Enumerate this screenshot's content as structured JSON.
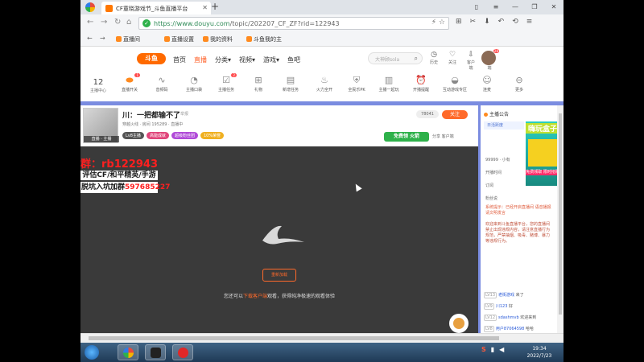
{
  "browser": {
    "tab_title": "CF童晓游戏节_斗鱼直播平台",
    "url_host": "https://www.douyu.com",
    "url_path": "/topic/202207_CF_ZF?rid=122943",
    "bookmarks": [
      "直播间",
      "直播设置",
      "我的资料",
      "斗鱼我的主"
    ]
  },
  "header": {
    "logo": "斗鱼",
    "nav": [
      "首页",
      "直播",
      "分类▾",
      "视频▾",
      "游戏▾",
      "鱼吧"
    ],
    "search_placeholder": "大神顾sola",
    "icons": [
      {
        "label": "历史",
        "icon": "history-icon"
      },
      {
        "label": "关注",
        "icon": "heart-icon"
      },
      {
        "label": "客户端",
        "icon": "download-icon"
      },
      {
        "label": "客户端",
        "icon": "gift-box-icon"
      }
    ],
    "avatar_badge": "28"
  },
  "toolbar": {
    "level_num": "12",
    "level_label": "主播中心",
    "tools": [
      {
        "label": "直播开关",
        "badge": "1"
      },
      {
        "label": "音频码",
        "badge": ""
      },
      {
        "label": "主播口袋",
        "badge": ""
      },
      {
        "label": "主播任务",
        "badge": "2"
      },
      {
        "label": "礼物",
        "badge": ""
      },
      {
        "label": "新增任务",
        "badge": ""
      },
      {
        "label": "火力全开",
        "badge": ""
      },
      {
        "label": "全民乐PK",
        "badge": ""
      },
      {
        "label": "主播一起玩",
        "badge": ""
      },
      {
        "label": "开播提醒",
        "badge": ""
      },
      {
        "label": "互动游戏专区",
        "badge": ""
      },
      {
        "label": "连麦",
        "badge": ""
      },
      {
        "label": "更多",
        "badge": ""
      }
    ]
  },
  "room": {
    "thumb_tag": "直播 · 主播",
    "title": "川：一把都输不了",
    "report": "举报",
    "meta": "穿越火线 · 房间 195289 · 直播中",
    "badges": [
      {
        "text": "Lv8主播",
        "color": "#555555"
      },
      {
        "text": "高能成就",
        "color": "#e0457a"
      },
      {
        "text": "超级粉丝团",
        "color": "#b04ad8"
      },
      {
        "text": "10%荣誉",
        "color": "#f0b020"
      }
    ],
    "count": "78041",
    "follow": "关注",
    "free_btn": "免费领 火箭",
    "links": "分享  客户端"
  },
  "player": {
    "qq_text": "群：rb122943",
    "ad_line1": "评估CF/和平精英/手游",
    "ad_line2_prefix": "脱坑入坑加群",
    "ad_line2_num": "597685227",
    "reload": "重新加载",
    "tip_prefix": "您还可以",
    "tip_link": "下载客户端",
    "tip_suffix": "观看，获得纯净极速的观看体验"
  },
  "side": {
    "title": "主播公告",
    "tab": "日活跃度",
    "line1": "99999 · 小有",
    "line2": "开播时间",
    "line3": "订阅",
    "line4": "粉丝说",
    "notice": "系统提示：已经开启直播间 语音播报 请文明发言",
    "notice2": "欢迎来到斗鱼直播平台，您的直播间禁止出现违规内容，请注意直播行为规范，严禁抽烟、吸毒、赌博、暴力等违规行为。",
    "chats": [
      {
        "lv": "LV13",
        "name": "老街游戏",
        "text": "来了"
      },
      {
        "lv": "LV9",
        "name": "川123",
        "text": "好"
      },
      {
        "lv": "LV12",
        "name": "sdashmvb",
        "text": "欢迎来到"
      },
      {
        "lv": "LV8",
        "name": "用户87064598",
        "text": "哈哈"
      }
    ],
    "promo_title": "嗨玩盒子",
    "promo_sub": "免费领取 限时抢购"
  },
  "taskbar": {
    "time": "19:34",
    "date": "2022/7/23"
  }
}
